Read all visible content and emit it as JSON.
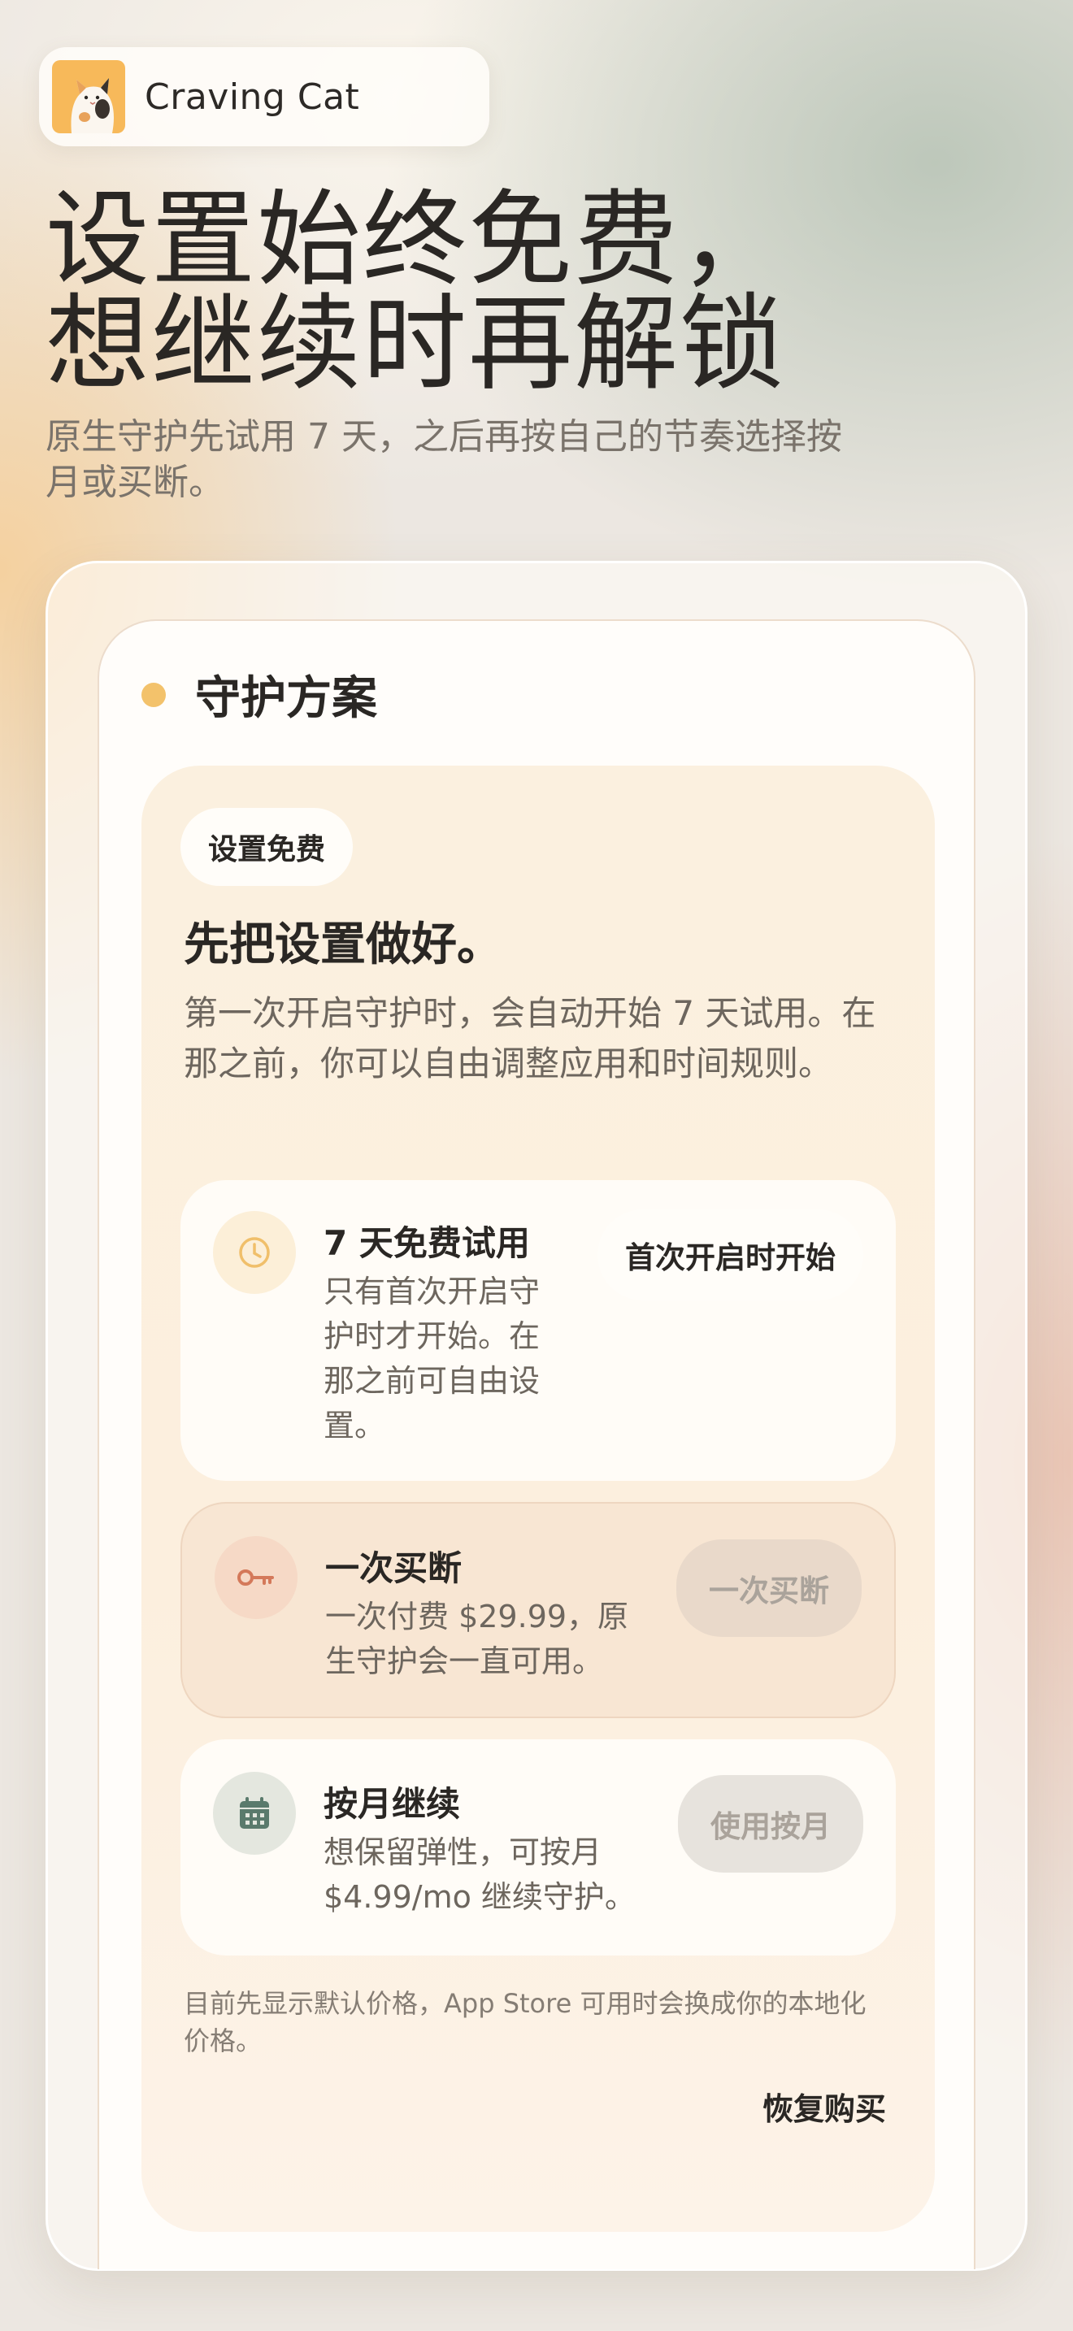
{
  "brand": {
    "name": "Craving Cat",
    "logo_icon": "calico-cat-logo"
  },
  "hero": {
    "title_line1": "设置始终免费，",
    "title_line2": "想继续时再解锁",
    "subtitle": "原生守护先试用 7 天，之后再按自己的节奏选择按月或买断。"
  },
  "panel": {
    "title": "守护方案",
    "dot_color": "#f3c26b"
  },
  "sheet": {
    "tag": "设置免费",
    "heading": "先把设置做好。",
    "description": "第一次开启守护时，会自动开始 7 天试用。在那之前，你可以自由调整应用和时间规则。"
  },
  "options": {
    "trial": {
      "icon": "clock-icon",
      "title": "7 天免费试用",
      "description": "只有首次开启守护时才开始。在那之前可自由设置。",
      "badge": "首次开启时开始"
    },
    "lifetime": {
      "icon": "key-icon",
      "title": "一次买断",
      "description": "一次付费 $29.99，原生守护会一直可用。",
      "button_label": "一次买断"
    },
    "monthly": {
      "icon": "calendar-icon",
      "title": "按月继续",
      "description": "想保留弹性，可按月 $4.99/mo 继续守护。",
      "button_label": "使用按月"
    }
  },
  "fine_print": "目前先显示默认价格，App Store 可用时会换成你的本地化价格。",
  "restore_label": "恢复购买",
  "colors": {
    "accent_yellow": "#f3c26b",
    "key_orange": "#d4795a",
    "calendar_green": "#5a7a6c"
  }
}
